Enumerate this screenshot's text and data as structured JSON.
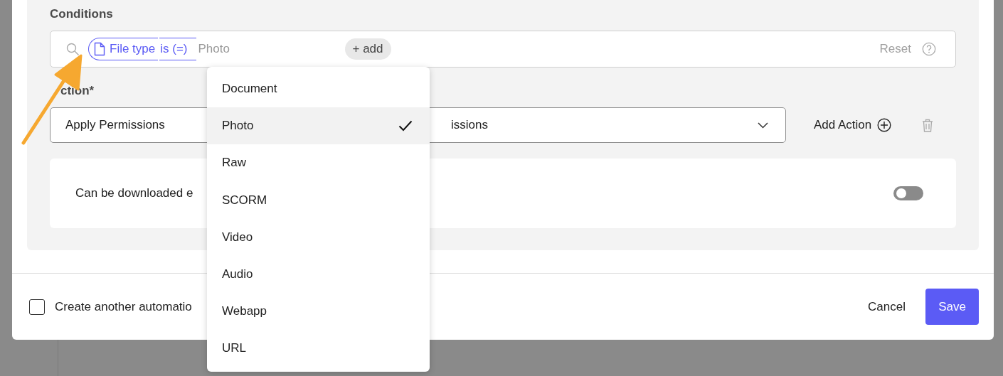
{
  "conditions": {
    "label": "Conditions",
    "chip_field": "File type",
    "chip_operator": "is (=)",
    "placeholder": "Photo",
    "add_button": "+ add",
    "reset": "Reset"
  },
  "action": {
    "label": "ction*",
    "select_value": "Apply Permissions",
    "second_value": "issions",
    "add_action": "Add Action"
  },
  "permission": {
    "label": "Can be downloaded e",
    "on": false
  },
  "footer": {
    "create_another": {
      "label": "Create another automatio",
      "checked": false
    },
    "buttons": [
      {
        "label": "Cancel",
        "kind": "text"
      },
      {
        "label": "Save",
        "kind": "primary"
      }
    ]
  },
  "dropdown": {
    "options": [
      {
        "label": "Document",
        "selected": false
      },
      {
        "label": "Photo",
        "selected": true
      },
      {
        "label": "Raw",
        "selected": false
      },
      {
        "label": "SCORM",
        "selected": false
      },
      {
        "label": "Video",
        "selected": false
      },
      {
        "label": "Audio",
        "selected": false
      },
      {
        "label": "Webapp",
        "selected": false
      },
      {
        "label": "URL",
        "selected": false
      }
    ]
  }
}
